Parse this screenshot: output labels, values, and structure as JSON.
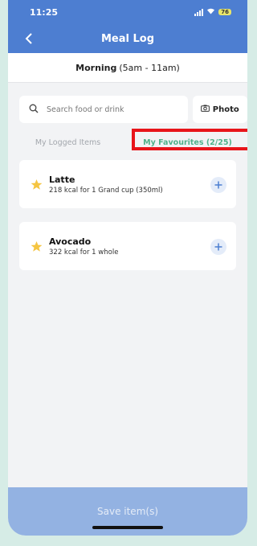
{
  "status": {
    "time": "11:25",
    "battery": "76"
  },
  "nav": {
    "title": "Meal Log"
  },
  "period": {
    "name": "Morning",
    "range": "(5am - 11am)"
  },
  "search": {
    "placeholder": "Search food or drink",
    "photo_label": "Photo"
  },
  "tabs": [
    {
      "label": "My Logged Items"
    },
    {
      "label": "My Favourites (2/25)"
    }
  ],
  "favourites": [
    {
      "name": "Latte",
      "desc": "218 kcal for 1 Grand cup (350ml)"
    },
    {
      "name": "Avocado",
      "desc": "322 kcal for 1 whole"
    }
  ],
  "footer": {
    "save_label": "Save item(s)"
  },
  "colors": {
    "header": "#4d7ed1",
    "accent_green": "#4fb18a",
    "highlight": "#e8141a",
    "star": "#f5c542",
    "save_bar": "#93b2e2"
  },
  "icons": [
    "back-chevron-icon",
    "search-icon",
    "camera-icon",
    "star-icon",
    "plus-icon",
    "signal-icon",
    "wifi-icon",
    "battery-icon"
  ]
}
